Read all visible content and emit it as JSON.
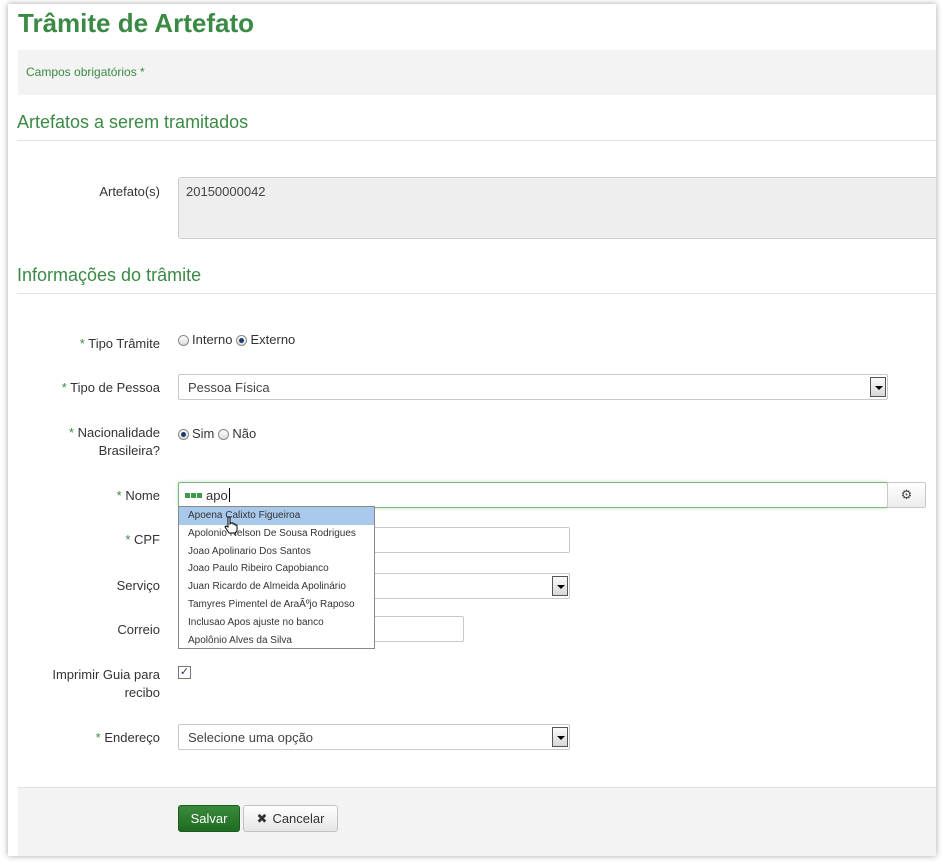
{
  "page": {
    "title": "Trâmite de Artefato",
    "required_note": "Campos obrigatórios *"
  },
  "sections": {
    "artefatos_title": "Artefatos a serem tramitados",
    "info_title": "Informações do trâmite"
  },
  "form": {
    "artefatos": {
      "label": "Artefato(s)",
      "value": "20150000042"
    },
    "tipo_tramite": {
      "label": "Tipo Trâmite",
      "required_mark": "*",
      "options": [
        {
          "label": "Interno",
          "checked": false
        },
        {
          "label": "Externo",
          "checked": true
        }
      ]
    },
    "tipo_pessoa": {
      "label": "Tipo de Pessoa",
      "required_mark": "*",
      "value": "Pessoa Física"
    },
    "nacionalidade": {
      "label_line1": "Nacionalidade",
      "label_line2": "Brasileira?",
      "required_mark": "*",
      "options": [
        {
          "label": "Sim",
          "checked": true
        },
        {
          "label": "Não",
          "checked": false
        }
      ]
    },
    "nome": {
      "label": "Nome",
      "required_mark": "*",
      "value": "apo"
    },
    "cpf": {
      "label": "CPF",
      "required_mark": "*",
      "value": ""
    },
    "servico": {
      "label": "Serviço",
      "value": ""
    },
    "correio": {
      "label": "Correio",
      "value": ""
    },
    "imprimir_guia": {
      "label_line1": "Imprimir Guia para",
      "label_line2": "recibo",
      "checked": true,
      "check_glyph": "✓"
    },
    "endereco": {
      "label": "Endereço",
      "required_mark": "*",
      "value": "Selecione uma opção"
    }
  },
  "autocomplete": {
    "items": [
      "Apoena Calixto Figueiroa",
      "Apolonio Nelson De Sousa Rodrigues",
      "Joao Apolinario Dos Santos",
      "Joao Paulo Ribeiro Capobianco",
      "Juan Ricardo de Almeida Apolinário",
      "Tamyres Pimentel de AraÃºjo Raposo",
      "Inclusao Apos ajuste no banco",
      "Apolônio Alves da Silva"
    ],
    "active_index": 0
  },
  "buttons": {
    "save": "Salvar",
    "cancel": "Cancelar",
    "cancel_icon": "✖",
    "gear_icon": "⚙"
  },
  "colors": {
    "accent_green": "#3a8a45",
    "save_button": "#2a7a2d",
    "autocomplete_highlight": "#a9c9ec"
  }
}
